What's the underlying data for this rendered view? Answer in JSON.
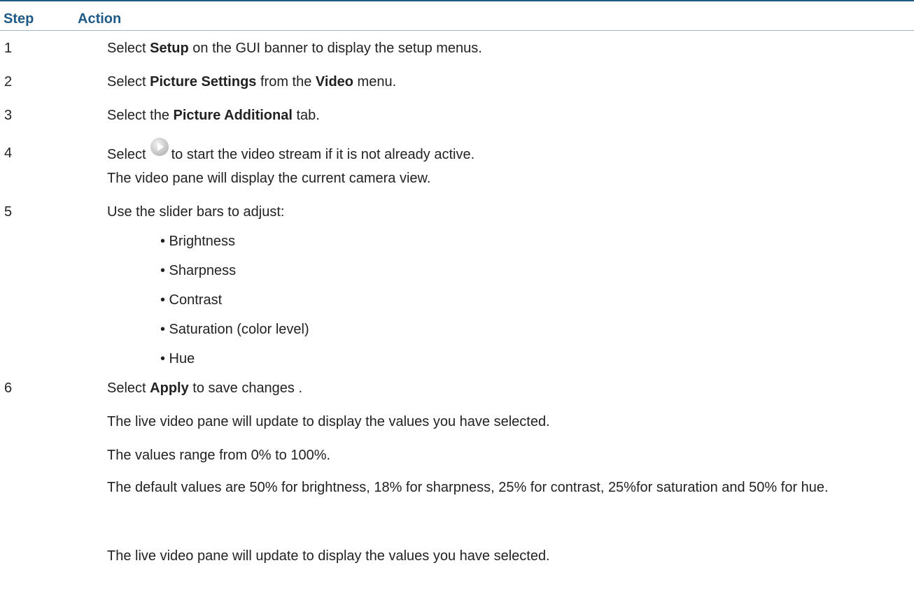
{
  "header": {
    "step_label": "Step",
    "action_label": "Action"
  },
  "steps": [
    {
      "number": "1",
      "pre": "Select ",
      "bold": "Setup",
      "post": " on the GUI banner to display the setup menus."
    },
    {
      "number": "2",
      "pre": "Select ",
      "bold": "Picture Settings",
      "mid": " from the ",
      "bold2": "Video",
      "post": " menu."
    },
    {
      "number": "3",
      "pre": "Select the ",
      "bold": "Picture Additional",
      "post": " tab."
    },
    {
      "number": "4",
      "pre": "Select",
      "icon": "play-icon",
      "post": "to start the video stream if it is not already active.",
      "note": "The video pane will display the current camera view."
    },
    {
      "number": "5",
      "text": "Use the slider bars to adjust:",
      "bullets": [
        "• Brightness",
        "• Sharpness",
        "• Contrast",
        "• Saturation (color level)",
        "• Hue"
      ]
    },
    {
      "number": "6",
      "pre": "Select ",
      "bold": "Apply",
      "post": " to save changes .",
      "notes": [
        "The live video pane will update to display the values you have selected.",
        "The values range from 0% to 100%.",
        "The default values are 50% for brightness, 18% for sharpness, 25% for contrast, 25%for saturation and 50% for hue.",
        "The live video pane will update to display the values you have selected."
      ]
    }
  ],
  "colors": {
    "header_text": "#1f5a87",
    "header_rule": "#1f5a87",
    "body_text": "#222222"
  }
}
